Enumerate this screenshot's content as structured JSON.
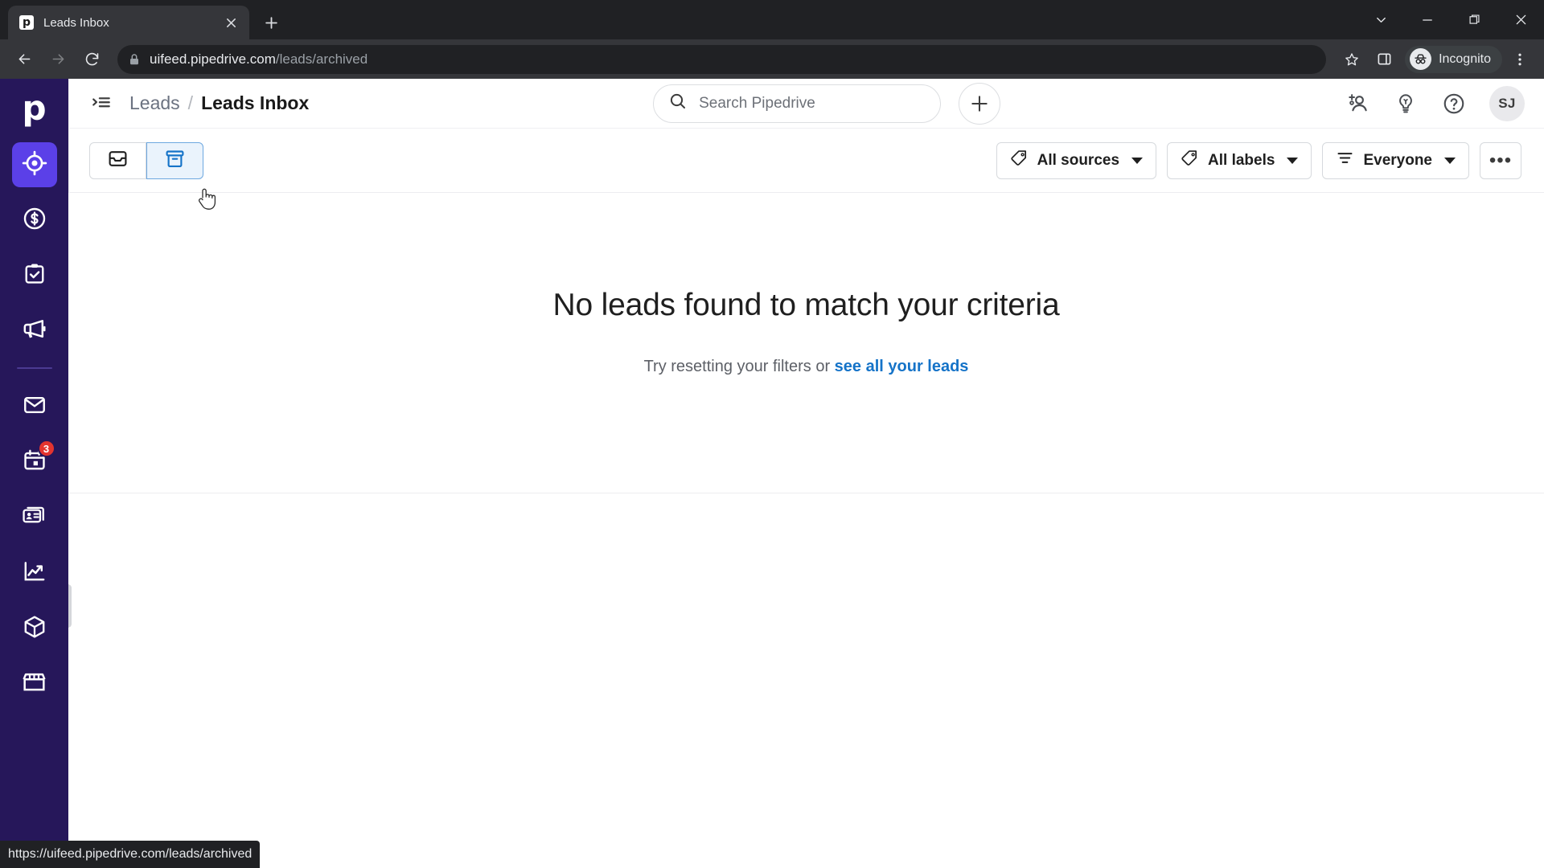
{
  "browser": {
    "tab": {
      "title": "Leads Inbox",
      "favicon_letter": "p",
      "favicon_name": "pipedrive-favicon"
    },
    "newtab_label": "+",
    "window_controls": {
      "search_tabs": "search-tabs",
      "minimize": "minimize",
      "maximize": "maximize",
      "close": "close"
    },
    "nav": {
      "back": "back",
      "forward": "forward",
      "reload": "reload"
    },
    "address": {
      "secure": true,
      "domain": "uifeed.pipedrive.com",
      "path": "/leads/archived",
      "full": "uifeed.pipedrive.com/leads/archived"
    },
    "actions": {
      "bookmark": "bookmark-star",
      "side_panel": "side-panel",
      "menu": "chrome-menu"
    },
    "incognito_label": "Incognito",
    "status_url": "https://uifeed.pipedrive.com/leads/archived"
  },
  "sidebar": {
    "logo": "p",
    "items": [
      {
        "name": "leads",
        "icon": "target-icon",
        "active": true,
        "badge": null
      },
      {
        "name": "deals",
        "icon": "dollar-circle-icon",
        "active": false,
        "badge": null
      },
      {
        "name": "activities",
        "icon": "clipboard-check-icon",
        "active": false,
        "badge": null
      },
      {
        "name": "campaigns",
        "icon": "megaphone-icon",
        "active": false,
        "badge": null
      },
      {
        "name": "mail",
        "icon": "envelope-icon",
        "active": false,
        "badge": null
      },
      {
        "name": "calendar",
        "icon": "calendar-icon",
        "active": false,
        "badge": "3"
      },
      {
        "name": "contacts",
        "icon": "contact-cards-icon",
        "active": false,
        "badge": null
      },
      {
        "name": "insights",
        "icon": "line-chart-icon",
        "active": false,
        "badge": null
      },
      {
        "name": "products",
        "icon": "box-icon",
        "active": false,
        "badge": null
      },
      {
        "name": "marketplace",
        "icon": "storefront-icon",
        "active": false,
        "badge": null
      }
    ]
  },
  "header": {
    "expand_icon": "expand-sidebar-icon",
    "breadcrumb": {
      "parent": "Leads",
      "separator": "/",
      "current": "Leads Inbox"
    },
    "search": {
      "placeholder": "Search Pipedrive",
      "value": "",
      "icon": "search-icon"
    },
    "add_button": "+",
    "icons": [
      {
        "name": "add-user-icon",
        "label": "invite-user"
      },
      {
        "name": "lightbulb-icon",
        "label": "whats-new"
      },
      {
        "name": "question-circle-icon",
        "label": "help"
      }
    ],
    "avatar_initials": "SJ"
  },
  "toolbar": {
    "views": [
      {
        "name": "inbox",
        "icon": "inbox-icon",
        "selected": false
      },
      {
        "name": "archive",
        "icon": "archive-icon",
        "selected": true
      }
    ],
    "filters": [
      {
        "name": "sources",
        "icon": "tag-icon",
        "label": "All sources",
        "caret": true
      },
      {
        "name": "labels",
        "icon": "tag-icon",
        "label": "All labels",
        "caret": true
      },
      {
        "name": "owner",
        "icon": "filter-icon",
        "label": "Everyone",
        "caret": true
      }
    ],
    "more_label": "•••"
  },
  "empty_state": {
    "title": "No leads found to match your criteria",
    "subtitle_prefix": "Try resetting your filters or ",
    "link_label": "see all your leads"
  },
  "colors": {
    "sidebar_bg": "#26175a",
    "active_nav": "#5b40e8",
    "accent_link": "#1573c8",
    "selected_seg_bg": "#eaf3fc",
    "badge_red": "#e3342f",
    "chrome_dark": "#202124",
    "chrome_toolbar": "#35363a"
  }
}
